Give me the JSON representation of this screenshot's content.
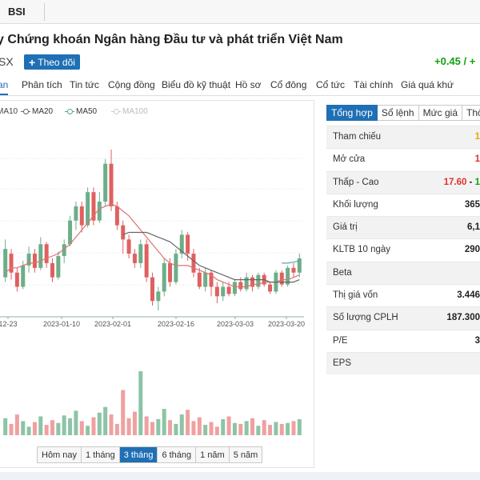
{
  "header": {
    "brand": "BSI"
  },
  "company": {
    "name": "y Chứng khoán Ngân hàng Đầu tư và phát triển Việt Nam",
    "exchange": "SX",
    "follow_label": "Theo dõi",
    "price_change": "+0.45 / +"
  },
  "tabs": [
    {
      "label": "an"
    },
    {
      "label": "Phân tích"
    },
    {
      "label": "Tin tức"
    },
    {
      "label": "Cộng đồng"
    },
    {
      "label": "Biểu đồ kỹ thuật"
    },
    {
      "label": "Hồ sơ"
    },
    {
      "label": "Cổ đông"
    },
    {
      "label": "Cổ tức"
    },
    {
      "label": "Tài chính"
    },
    {
      "label": "Giá quá khứ"
    }
  ],
  "ma_legend": [
    {
      "label": "MA10",
      "color": "#e07070"
    },
    {
      "label": "MA20",
      "color": "#666666"
    },
    {
      "label": "MA50",
      "color": "#5aa5a0"
    },
    {
      "label": "MA100",
      "color": "#cccccc"
    }
  ],
  "chart_data": {
    "type": "candlestick",
    "x_tick_labels": [
      "12-23",
      "2023-01-10",
      "2023-02-01",
      "2023-02-16",
      "2023-03-03",
      "2023-03-20"
    ],
    "candles": [
      [
        17.1,
        17.7,
        17.0,
        17.9
      ],
      [
        17.6,
        17.2,
        17.05,
        17.7
      ],
      [
        17.2,
        16.9,
        16.8,
        17.3
      ],
      [
        16.9,
        17.35,
        16.85,
        17.45
      ],
      [
        17.35,
        17.6,
        17.2,
        17.75
      ],
      [
        17.6,
        17.3,
        17.2,
        17.7
      ],
      [
        17.3,
        17.8,
        17.25,
        17.95
      ],
      [
        17.8,
        17.4,
        17.3,
        17.85
      ],
      [
        17.4,
        17.1,
        17.0,
        17.5
      ],
      [
        17.1,
        17.55,
        17.05,
        17.65
      ],
      [
        17.55,
        17.8,
        17.4,
        17.9
      ],
      [
        17.8,
        18.3,
        17.75,
        18.4
      ],
      [
        18.3,
        18.6,
        18.1,
        18.7
      ],
      [
        18.6,
        18.2,
        18.05,
        18.7
      ],
      [
        18.2,
        18.9,
        18.15,
        19.0
      ],
      [
        18.9,
        18.3,
        18.2,
        19.0
      ],
      [
        18.3,
        18.7,
        18.25,
        18.9
      ],
      [
        18.7,
        19.5,
        18.6,
        19.6
      ],
      [
        19.5,
        18.6,
        18.5,
        19.8
      ],
      [
        18.6,
        18.2,
        18.1,
        18.7
      ],
      [
        18.2,
        17.9,
        17.6,
        18.3
      ],
      [
        17.9,
        17.6,
        17.5,
        18.0
      ],
      [
        17.6,
        17.4,
        17.3,
        17.7
      ],
      [
        17.4,
        17.8,
        17.3,
        17.9
      ],
      [
        17.8,
        17.1,
        17.0,
        17.9
      ],
      [
        17.1,
        16.6,
        16.5,
        17.2
      ],
      [
        16.6,
        16.8,
        16.4,
        16.9
      ],
      [
        16.8,
        17.4,
        16.7,
        17.5
      ],
      [
        17.4,
        17.0,
        16.9,
        17.5
      ],
      [
        17.0,
        17.6,
        16.95,
        17.7
      ],
      [
        17.6,
        18.0,
        17.5,
        18.1
      ],
      [
        18.0,
        17.6,
        17.45,
        18.05
      ],
      [
        17.6,
        17.2,
        17.1,
        17.7
      ],
      [
        17.2,
        16.9,
        16.85,
        17.3
      ],
      [
        16.9,
        17.2,
        16.8,
        17.3
      ],
      [
        17.2,
        16.9,
        16.7,
        17.25
      ],
      [
        16.9,
        16.7,
        16.55,
        17.0
      ],
      [
        16.7,
        16.9,
        16.6,
        17.0
      ],
      [
        16.9,
        16.75,
        16.7,
        17.0
      ],
      [
        16.75,
        17.0,
        16.7,
        17.05
      ],
      [
        17.0,
        16.85,
        16.8,
        17.1
      ],
      [
        16.85,
        17.1,
        16.8,
        17.2
      ],
      [
        17.1,
        16.9,
        16.8,
        17.15
      ],
      [
        16.9,
        17.15,
        16.85,
        17.2
      ],
      [
        17.15,
        16.95,
        16.9,
        17.2
      ],
      [
        16.95,
        16.8,
        16.75,
        17.0
      ],
      [
        16.8,
        17.2,
        16.75,
        17.25
      ],
      [
        17.2,
        16.95,
        16.9,
        17.25
      ],
      [
        16.95,
        17.3,
        16.9,
        17.35
      ],
      [
        17.3,
        17.2,
        17.1,
        17.4
      ],
      [
        17.2,
        17.5,
        17.1,
        17.6
      ]
    ],
    "volume": [
      18,
      12,
      22,
      15,
      9,
      14,
      20,
      11,
      16,
      13,
      21,
      18,
      26,
      15,
      10,
      19,
      24,
      30,
      22,
      12,
      48,
      18,
      25,
      68,
      20,
      14,
      17,
      28,
      16,
      12,
      22,
      27,
      15,
      19,
      11,
      14,
      9,
      17,
      20,
      13,
      12,
      15,
      18,
      10,
      16,
      11,
      14,
      12,
      13,
      15,
      17
    ],
    "ma10": [
      17.2,
      17.3,
      17.3,
      17.35,
      17.4,
      17.4,
      17.45,
      17.5,
      17.55,
      17.6,
      17.7,
      17.8,
      17.95,
      18.1,
      18.25,
      18.4,
      18.55,
      18.6,
      18.65,
      18.6,
      18.5,
      18.4,
      18.25,
      18.1,
      17.95,
      17.8,
      17.65,
      17.5,
      17.4,
      17.35,
      17.35,
      17.35,
      17.3,
      17.25,
      17.2,
      17.15,
      17.05,
      17.0,
      16.95,
      16.9,
      16.9,
      16.9,
      16.95,
      16.95,
      17.0,
      17.0,
      17.0,
      17.05,
      17.05,
      17.1,
      17.15
    ],
    "ma20": [
      null,
      null,
      null,
      null,
      null,
      null,
      null,
      null,
      null,
      null,
      null,
      null,
      null,
      null,
      null,
      null,
      null,
      null,
      null,
      null,
      18.0,
      18.05,
      18.05,
      18.05,
      18.05,
      18.0,
      17.95,
      17.9,
      17.85,
      17.75,
      17.65,
      17.55,
      17.45,
      17.35,
      17.3,
      17.25,
      17.2,
      17.15,
      17.1,
      17.05,
      17.05,
      17.05,
      17.05,
      17.05,
      17.05,
      17.0,
      17.0,
      17.0,
      17.0,
      17.0,
      17.05
    ],
    "ma50": [
      null,
      null,
      null,
      null,
      null,
      null,
      null,
      null,
      null,
      null,
      null,
      null,
      null,
      null,
      null,
      null,
      null,
      null,
      null,
      null,
      null,
      null,
      null,
      null,
      null,
      null,
      null,
      null,
      null,
      null,
      null,
      null,
      null,
      null,
      null,
      null,
      null,
      null,
      null,
      null,
      null,
      null,
      null,
      null,
      null,
      null,
      null,
      17.4,
      17.4,
      17.42,
      17.45
    ]
  },
  "range_buttons": [
    {
      "label": "Hôm nay"
    },
    {
      "label": "1 tháng"
    },
    {
      "label": "3 tháng"
    },
    {
      "label": "6 tháng"
    },
    {
      "label": "1 năm"
    },
    {
      "label": "5 năm"
    }
  ],
  "info_tabs": [
    {
      "label": "Tổng hợp"
    },
    {
      "label": "Sổ lệnh"
    },
    {
      "label": "Mức giá"
    },
    {
      "label": "Thống"
    }
  ],
  "info_rows": [
    {
      "label": "Tham chiếu",
      "value": "1"
    },
    {
      "label": "Mở cửa",
      "value": "1"
    },
    {
      "label": "Thấp - Cao",
      "low": "17.60",
      "sep": " - ",
      "high": "1"
    },
    {
      "label": "Khối lượng",
      "value": "365"
    },
    {
      "label": "Giá trị",
      "value": "6,1"
    },
    {
      "label": "KLTB 10 ngày",
      "value": "290"
    },
    {
      "label": "Beta",
      "value": ""
    },
    {
      "label": "Thị giá vốn",
      "value": "3.446"
    },
    {
      "label": "Số lượng CPLH",
      "value": "187.300"
    },
    {
      "label": "P/E",
      "value": "3"
    },
    {
      "label": "EPS",
      "value": ""
    }
  ]
}
